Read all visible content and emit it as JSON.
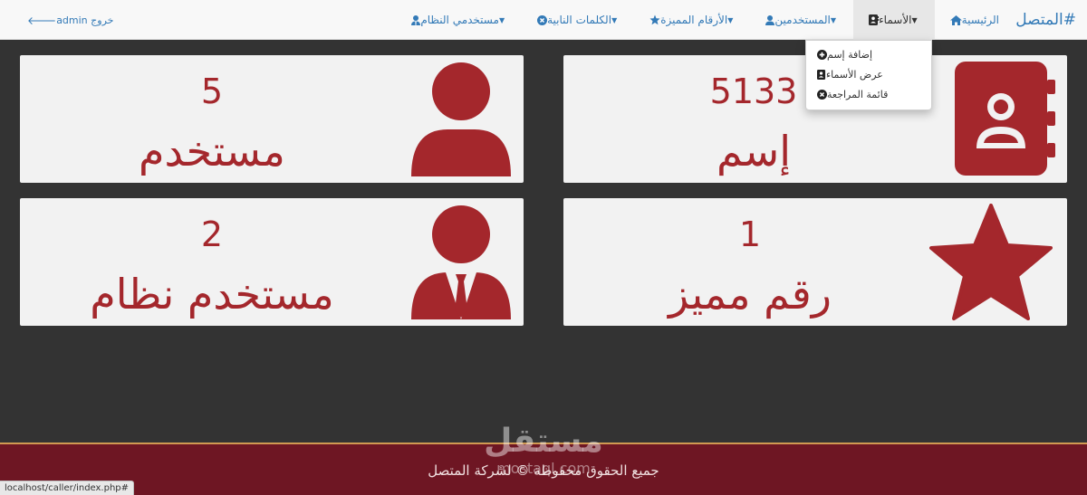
{
  "navbar": {
    "brand": "#المتصل",
    "items": [
      {
        "label": "الرئيسية",
        "icon": "home-icon",
        "has_caret": false
      },
      {
        "label": "الأسماء",
        "icon": "address-book-icon",
        "has_caret": true,
        "open": true
      },
      {
        "label": "المستخدمين",
        "icon": "user-icon",
        "has_caret": true
      },
      {
        "label": "الأرقام المميزة",
        "icon": "star-icon",
        "has_caret": true
      },
      {
        "label": "الكلمات النابية",
        "icon": "times-circle-icon",
        "has_caret": true
      },
      {
        "label": "مستخدمي النظام",
        "icon": "user-tie-icon",
        "has_caret": true
      }
    ],
    "logout_label": "خروج admin",
    "logout_icon": "arrow-left-icon"
  },
  "dropdown": {
    "items": [
      {
        "label": "إضافة إسم",
        "icon": "plus-circle-icon"
      },
      {
        "label": "عرض الأسماء",
        "icon": "address-book-icon"
      },
      {
        "label": "قائمة المراجعة",
        "icon": "times-circle-icon"
      }
    ]
  },
  "cards": {
    "names": {
      "value": "5133",
      "label": "إسم",
      "icon": "address-book-icon"
    },
    "users": {
      "value": "5",
      "label": "مستخدم",
      "icon": "user-icon"
    },
    "special_numbers": {
      "value": "1",
      "label": "رقم مميز",
      "icon": "star-icon"
    },
    "system_users": {
      "value": "2",
      "label": "مستخدم نظام",
      "icon": "user-tie-icon"
    }
  },
  "footer": {
    "text": "جميع الحقوق محفوظة © لشركة المتصل"
  },
  "watermark": {
    "arabic": "مستقل",
    "latin": "mostaql.com"
  },
  "statusbar": {
    "url": "localhost/caller/index.php#"
  },
  "colors": {
    "accent": "#a4272c",
    "link": "#337ab7",
    "background": "#333333",
    "footer": "#6e1623",
    "footer_border": "#d19a52"
  }
}
